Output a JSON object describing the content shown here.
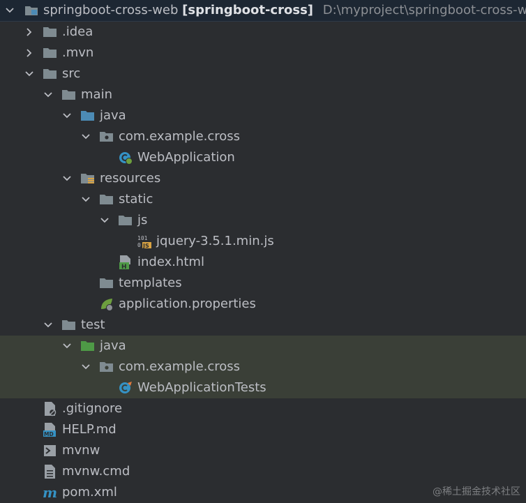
{
  "project": {
    "name": "springboot-cross-web",
    "module": "[springboot-cross]",
    "path": "D:\\myproject\\springboot-cross-web"
  },
  "tree": {
    "idea": ".idea",
    "mvn": ".mvn",
    "src": "src",
    "main": "main",
    "main_java": "java",
    "main_pkg": "com.example.cross",
    "web_application": "WebApplication",
    "resources": "resources",
    "static": "static",
    "js": "js",
    "jquery": "jquery-3.5.1.min.js",
    "index_html": "index.html",
    "templates": "templates",
    "app_props": "application.properties",
    "test": "test",
    "test_java": "java",
    "test_pkg": "com.example.cross",
    "web_application_tests": "WebApplicationTests",
    "gitignore": ".gitignore",
    "help_md": "HELP.md",
    "mvnw": "mvnw",
    "mvnw_cmd": "mvnw.cmd",
    "pom_xml": "pom.xml"
  },
  "watermark": "@稀土掘金技术社区",
  "colors": {
    "background": "#2b2d30",
    "selected_root": "#1d2733",
    "test_highlight": "#3a3f37",
    "folder": "#7f8b91",
    "source_folder": "#4c8bb5",
    "test_folder": "#4e9a46"
  }
}
